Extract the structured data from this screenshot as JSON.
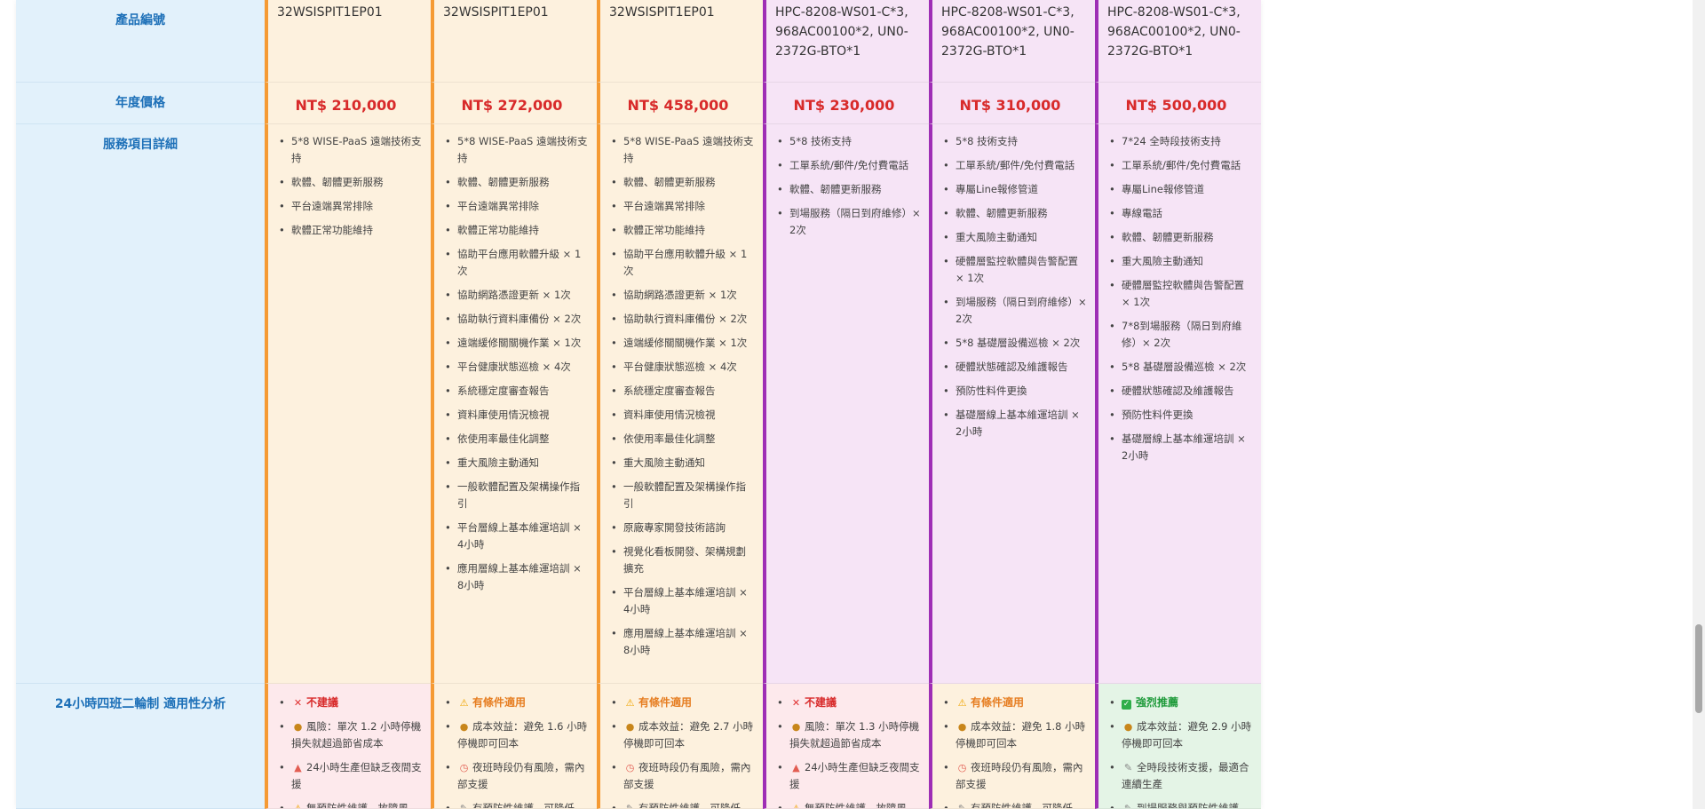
{
  "labels": {
    "product_code": "產品編號",
    "annual_price": "年度價格",
    "service_details": "服務項目詳細",
    "fit_analysis": "24小時四班二輪制 適用性分析"
  },
  "plans": [
    {
      "group": "wise",
      "code": "32WSISPIT1EP01",
      "price": "NT$ 210,000",
      "services": [
        "5*8 WISE-PaaS 遠端技術支持",
        "軟體、韌體更新服務",
        "平台遠端異常排除",
        "軟體正常功能維持"
      ],
      "fit": {
        "level": "bad",
        "items": [
          {
            "icon": "x",
            "text": "不建議"
          },
          {
            "icon": "money",
            "text": "風險：單次 1.2 小時停機損失就超過節省成本"
          },
          {
            "icon": "bell",
            "text": "24小時生產但缺乏夜間支援"
          },
          {
            "icon": "warn",
            "text": "無預防性維護，故障風"
          }
        ]
      }
    },
    {
      "group": "wise",
      "code": "32WSISPIT1EP01",
      "price": "NT$ 272,000",
      "services": [
        "5*8 WISE-PaaS 遠端技術支持",
        "軟體、韌體更新服務",
        "平台遠端異常排除",
        "軟體正常功能維持",
        "協助平台應用軟體升級 × 1次",
        "協助網路憑證更新 × 1次",
        "協助執行資料庫備份 × 2次",
        "遠端緩修關關機作業 × 1次",
        "平台健康狀態巡檢 × 4次",
        "系統穩定度審查報告",
        "資料庫使用情況檢視",
        "依使用率最佳化調整",
        "重大風險主動通知",
        "一般軟體配置及架構操作指引",
        "平台層線上基本維運培訓 × 4小時",
        "應用層線上基本維運培訓 × 8小時"
      ],
      "fit": {
        "level": "mid",
        "items": [
          {
            "icon": "warn",
            "text": "有條件適用"
          },
          {
            "icon": "money",
            "text": "成本效益：避免 1.6 小時停機即可回本"
          },
          {
            "icon": "clock",
            "text": "夜班時段仍有風險，需內部支援"
          },
          {
            "icon": "tool",
            "text": "有預防性維護，可降低"
          }
        ]
      }
    },
    {
      "group": "wise",
      "code": "32WSISPIT1EP01",
      "price": "NT$ 458,000",
      "services": [
        "5*8 WISE-PaaS 遠端技術支持",
        "軟體、韌體更新服務",
        "平台遠端異常排除",
        "軟體正常功能維持",
        "協助平台應用軟體升級 × 1次",
        "協助網路憑證更新 × 1次",
        "協助執行資料庫備份 × 2次",
        "遠端緩修關關機作業 × 1次",
        "平台健康狀態巡檢 × 4次",
        "系統穩定度審查報告",
        "資料庫使用情況檢視",
        "依使用率最佳化調整",
        "重大風險主動通知",
        "一般軟體配置及架構操作指引",
        "原廠專家開發技術諮詢",
        "視覺化看板開發、架構規劃擴充",
        "平台層線上基本維運培訓 × 4小時",
        "應用層線上基本維運培訓 × 8小時"
      ],
      "fit": {
        "level": "mid",
        "items": [
          {
            "icon": "warn",
            "text": "有條件適用"
          },
          {
            "icon": "money",
            "text": "成本效益：避免 2.7 小時停機即可回本"
          },
          {
            "icon": "clock",
            "text": "夜班時段仍有風險，需內部支援"
          },
          {
            "icon": "tool",
            "text": "有預防性維護，可降低"
          }
        ]
      }
    },
    {
      "group": "hpc",
      "code": "HPC-8208-WS01-C*3, 968AC00100*2, UN0-2372G-BTO*1",
      "price": "NT$ 230,000",
      "services": [
        "5*8 技術支持",
        "工單系統/郵件/免付費電話",
        "軟體、韌體更新服務",
        "到場服務（隔日到府維修）× 2次"
      ],
      "fit": {
        "level": "bad",
        "items": [
          {
            "icon": "x",
            "text": "不建議"
          },
          {
            "icon": "money",
            "text": "風險：單次 1.3 小時停機損失就超過節省成本"
          },
          {
            "icon": "bell",
            "text": "24小時生產但缺乏夜間支援"
          },
          {
            "icon": "warn",
            "text": "無預防性維護，故障風"
          }
        ]
      }
    },
    {
      "group": "hpc",
      "code": "HPC-8208-WS01-C*3, 968AC00100*2, UN0-2372G-BTO*1",
      "price": "NT$ 310,000",
      "services": [
        "5*8 技術支持",
        "工單系統/郵件/免付費電話",
        "專屬Line報修管道",
        "軟體、韌體更新服務",
        "重大風險主動通知",
        "硬體層監控軟體與告警配置 × 1次",
        "到場服務（隔日到府維修）× 2次",
        "5*8 基礎層設備巡檢 × 2次",
        "硬體狀態確認及維護報告",
        "預防性料件更換",
        "基礎層線上基本維運培訓 × 2小時"
      ],
      "fit": {
        "level": "mid",
        "items": [
          {
            "icon": "warn",
            "text": "有條件適用"
          },
          {
            "icon": "money",
            "text": "成本效益：避免 1.8 小時停機即可回本"
          },
          {
            "icon": "clock",
            "text": "夜班時段仍有風險，需內部支援"
          },
          {
            "icon": "tool",
            "text": "有預防性維護，可降低"
          }
        ]
      }
    },
    {
      "group": "hpc",
      "code": "HPC-8208-WS01-C*3, 968AC00100*2, UN0-2372G-BTO*1",
      "price": "NT$ 500,000",
      "services": [
        "7*24 全時段技術支持",
        "工單系統/郵件/免付費電話",
        "專屬Line報修管道",
        "專線電話",
        "軟體、韌體更新服務",
        "重大風險主動通知",
        "硬體層監控軟體與告警配置 × 1次",
        "7*8到場服務（隔日到府維修）× 2次",
        "5*8 基礎層設備巡檢 × 2次",
        "硬體狀態確認及維護報告",
        "預防性料件更換",
        "基礎層線上基本維運培訓 × 2小時"
      ],
      "fit": {
        "level": "good",
        "items": [
          {
            "icon": "check",
            "text": "強烈推薦"
          },
          {
            "icon": "money",
            "text": "成本效益：避免 2.9 小時停機即可回本"
          },
          {
            "icon": "tool",
            "text": "全時段技術支援，最適合連續生產"
          },
          {
            "icon": "tool",
            "text": "到場服務與預防性維護"
          }
        ]
      }
    }
  ]
}
